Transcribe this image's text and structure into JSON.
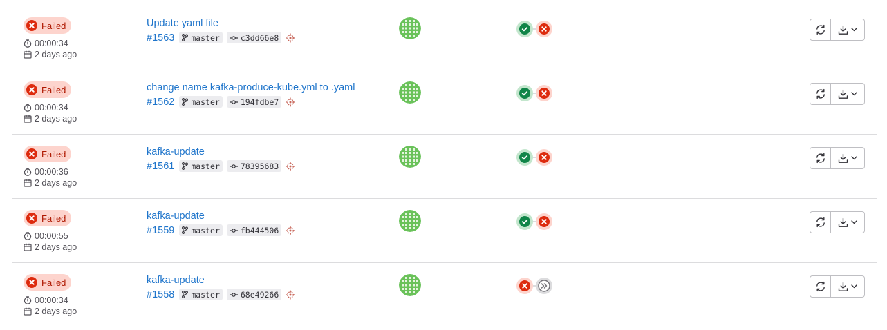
{
  "pipelines": [
    {
      "status": "Failed",
      "duration": "00:00:34",
      "finished": "2 days ago",
      "commit_title": "Update yaml file",
      "id": "#1563",
      "branch": "master",
      "sha": "c3dd66e8",
      "stages": [
        "success",
        "failed"
      ]
    },
    {
      "status": "Failed",
      "duration": "00:00:34",
      "finished": "2 days ago",
      "commit_title": "change name kafka-produce-kube.yml to .yaml",
      "id": "#1562",
      "branch": "master",
      "sha": "194fdbe7",
      "stages": [
        "success",
        "failed"
      ]
    },
    {
      "status": "Failed",
      "duration": "00:00:36",
      "finished": "2 days ago",
      "commit_title": "kafka-update",
      "id": "#1561",
      "branch": "master",
      "sha": "78395683",
      "stages": [
        "success",
        "failed"
      ]
    },
    {
      "status": "Failed",
      "duration": "00:00:55",
      "finished": "2 days ago",
      "commit_title": "kafka-update",
      "id": "#1559",
      "branch": "master",
      "sha": "fb444506",
      "stages": [
        "success",
        "failed"
      ]
    },
    {
      "status": "Failed",
      "duration": "00:00:34",
      "finished": "2 days ago",
      "commit_title": "kafka-update",
      "id": "#1558",
      "branch": "master",
      "sha": "68e49266",
      "stages": [
        "failed",
        "skipped"
      ]
    }
  ],
  "icons": {
    "status": "status-failed-icon",
    "duration": "timer-icon",
    "finished": "calendar-icon",
    "branch": "branch-icon",
    "commit": "commit-icon",
    "trigger": "trigger-icon",
    "retry": "retry-icon",
    "download": "download-icon",
    "dropdown": "chevron-down-icon"
  },
  "colors": {
    "failed": "#dd2b0e",
    "failed_bg": "#fdd4cd",
    "success": "#108548",
    "success_bg": "#c3e6cd",
    "skipped": "#737278",
    "link": "#1f75cb",
    "avatar": "#6ac25a"
  }
}
